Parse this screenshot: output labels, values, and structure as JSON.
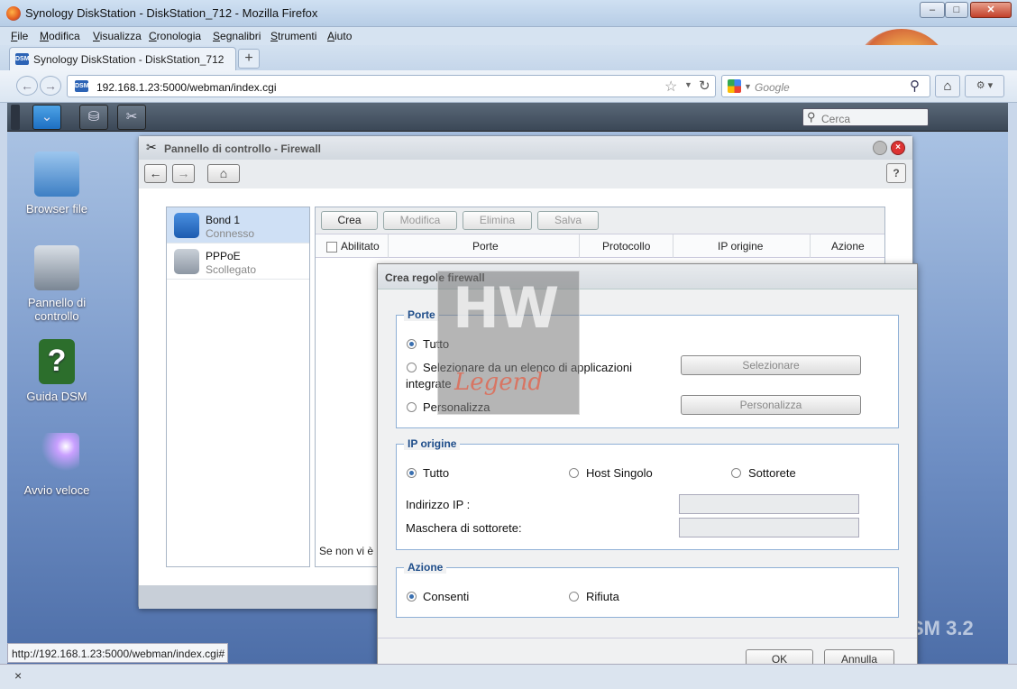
{
  "window": {
    "title": "Synology DiskStation - DiskStation_712 - Mozilla Firefox",
    "min": "–",
    "max": "□",
    "close": "✕"
  },
  "menu": [
    "File",
    "Modifica",
    "Visualizza",
    "Cronologia",
    "Segnalibri",
    "Strumenti",
    "Aiuto"
  ],
  "tab": {
    "title": "Synology DiskStation - DiskStation_712",
    "new": "+",
    "close": "×",
    "favicon": "DSM"
  },
  "nav": {
    "url": "192.168.1.23:5000/webman/index.cgi",
    "search_placeholder": "Google",
    "back": "←",
    "forward": "→"
  },
  "dsm": {
    "search_placeholder": "Cerca"
  },
  "desktop": [
    {
      "label": "Browser file",
      "icon": "folder-search-icon"
    },
    {
      "label": "Pannello di controllo",
      "icon": "tools-icon"
    },
    {
      "label": "Guida DSM",
      "icon": "help-book-icon"
    },
    {
      "label": "Avvio veloce",
      "icon": "magic-wand-icon"
    }
  ],
  "desktop_brand": "SM 3.2",
  "control_panel": {
    "title": "Pannello di controllo - Firewall",
    "help": "?",
    "interfaces": [
      {
        "name": "Bond 1",
        "status": "Connesso"
      },
      {
        "name": "PPPoE",
        "status": "Scollegato"
      }
    ],
    "toolbar": {
      "crea": "Crea",
      "modifica": "Modifica",
      "elimina": "Elimina",
      "salva": "Salva"
    },
    "columns": [
      "Abilitato",
      "Porte",
      "Protocollo",
      "IP origine",
      "Azione"
    ],
    "empty_text": "Se non vi è"
  },
  "dialog": {
    "title": "Crea regole firewall",
    "porte": {
      "legend": "Porte",
      "tutto": "Tutto",
      "selezionare": "Selezionare da un elenco di applicazioni",
      "selezionare2": "integrate",
      "personalizza": "Personalizza",
      "btn_selezionare": "Selezionare",
      "btn_personalizza": "Personalizza"
    },
    "ip": {
      "legend": "IP origine",
      "tutto": "Tutto",
      "host": "Host Singolo",
      "sottorete": "Sottorete",
      "indirizzo": "Indirizzo IP :",
      "maschera": "Maschera di sottorete:"
    },
    "azione": {
      "legend": "Azione",
      "consenti": "Consenti",
      "rifiuta": "Rifiuta"
    },
    "ok": "OK",
    "annulla": "Annulla"
  },
  "watermark": {
    "top": "HW",
    "bottom": "Legend"
  },
  "status_url": "http://192.168.1.23:5000/webman/index.cgi#",
  "addon_close": "×",
  "colors": {
    "accent": "#1e4d8a",
    "dsm_button": "#1d6fc2"
  }
}
